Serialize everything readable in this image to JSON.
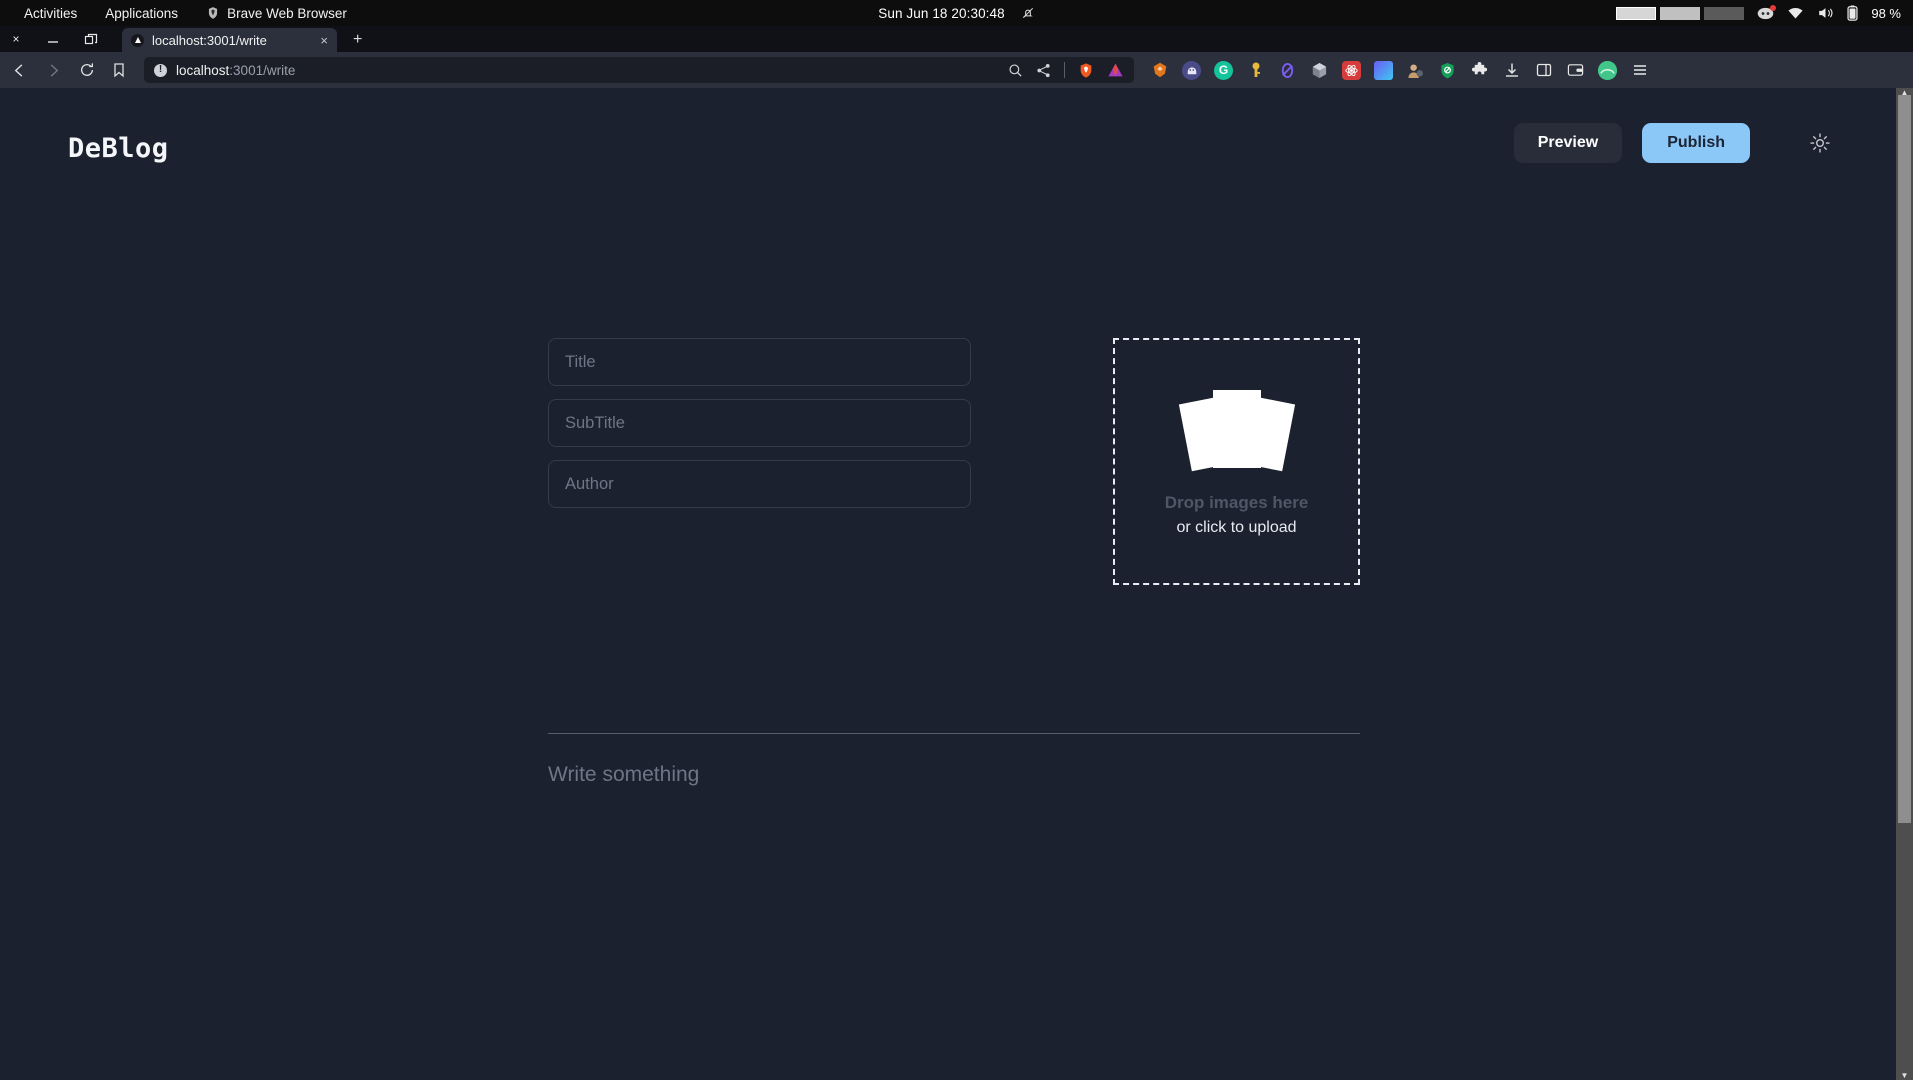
{
  "system_bar": {
    "activities": "Activities",
    "applications": "Applications",
    "app_name": "Brave Web Browser",
    "brave_icon": "brave-lion-icon",
    "clock": "Sun Jun 18  20:30:48",
    "notification_icon": "bell-muted-icon",
    "workspaces": [
      "active",
      "mid",
      "dim"
    ],
    "tray": {
      "discord_icon": "discord-icon",
      "discord_badge": true,
      "wifi_icon": "wifi-icon",
      "volume_icon": "volume-icon",
      "battery_icon": "battery-icon",
      "battery_level": "98 %"
    }
  },
  "browser": {
    "window_controls": {
      "close": "×",
      "minimize": "—",
      "maximize": "❐"
    },
    "tab": {
      "title": "localhost:3001/write",
      "favicon": "triangle-circle-favicon",
      "close": "×"
    },
    "new_tab": "+",
    "nav": {
      "back": "back-icon",
      "forward": "forward-icon",
      "reload": "reload-icon",
      "bookmark": "bookmark-icon"
    },
    "url": {
      "host": "localhost",
      "path": ":3001/write",
      "info_icon": "!"
    },
    "url_actions": {
      "zoom": "search-zoom-icon",
      "share": "share-icon",
      "shield": "brave-shield-icon",
      "rewards": "brave-rewards-icon"
    },
    "extensions": [
      {
        "name": "metamask-icon",
        "color": "#e2761b",
        "glyph": "🦊"
      },
      {
        "name": "phantom-wallet-icon",
        "color": "#4b4b7a",
        "glyph": "●"
      },
      {
        "name": "grammarly-icon",
        "color": "#15c39a",
        "glyph": "G"
      },
      {
        "name": "keeper-key-icon",
        "color": "#3b3b3b",
        "glyph": "🔑"
      },
      {
        "name": "ethereum-extension-icon",
        "color": "#5c3fd6",
        "glyph": "◎"
      },
      {
        "name": "cube-extension-icon",
        "color": "#8a8f99",
        "glyph": "⬡"
      },
      {
        "name": "react-devtools-icon",
        "color": "#d63c3c",
        "glyph": "⚛"
      },
      {
        "name": "gradient-square-icon",
        "color": "#4f74ff",
        "glyph": ""
      },
      {
        "name": "profile-extension-icon",
        "color": "#c8a27a",
        "glyph": "●"
      },
      {
        "name": "shield-extension-icon",
        "color": "#14a05a",
        "glyph": "⛨"
      },
      {
        "name": "extensions-puzzle-icon",
        "color": "#e8e8e8",
        "glyph": "🧩"
      },
      {
        "name": "downloads-icon",
        "color": "#e8e8e8",
        "glyph": "⬇"
      },
      {
        "name": "sidebar-toggle-icon",
        "color": "#e8e8e8",
        "glyph": "▫"
      },
      {
        "name": "brave-wallet-icon",
        "color": "#e8e8e8",
        "glyph": "▤"
      },
      {
        "name": "profile-avatar-icon",
        "color": "#3bbd7e",
        "glyph": ""
      },
      {
        "name": "browser-menu-icon",
        "color": "#e8e8e8",
        "glyph": "☰"
      }
    ]
  },
  "app": {
    "logo": "DeBlog",
    "preview_label": "Preview",
    "publish_label": "Publish",
    "theme_toggle_icon": "sun-icon",
    "accent_color": "#8cc8f7",
    "background_color": "#1b212e",
    "fields": [
      {
        "name": "title-input",
        "placeholder": "Title",
        "value": ""
      },
      {
        "name": "subtitle-input",
        "placeholder": "SubTitle",
        "value": ""
      },
      {
        "name": "author-input",
        "placeholder": "Author",
        "value": ""
      }
    ],
    "dropzone": {
      "icon": "stacked-images-icon",
      "primary": "Drop images here",
      "secondary": "or click to upload"
    },
    "body": {
      "placeholder": "Write something",
      "value": ""
    }
  },
  "scrollbar": {
    "up_arrow": "▲",
    "down_arrow": "▼"
  }
}
